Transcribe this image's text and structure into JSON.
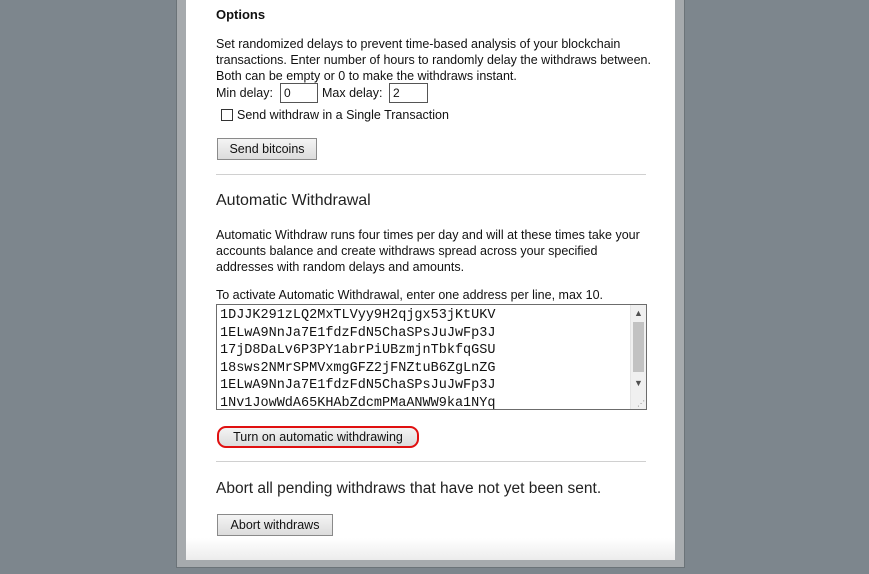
{
  "options": {
    "title": "Options",
    "description": "Set randomized delays to prevent time-based analysis of your blockchain transactions. Enter number of hours to randomly delay the withdraws between. Both can be empty or 0 to make the withdraws instant.",
    "min_delay_label": "Min delay:",
    "min_delay_value": "0",
    "max_delay_label": "Max delay:",
    "max_delay_value": "2",
    "single_tx_label": "Send withdraw in a Single Transaction",
    "single_tx_checked": false,
    "send_button": "Send bitcoins"
  },
  "automatic": {
    "title": "Automatic Withdrawal",
    "description": "Automatic Withdraw runs four times per day and will at these times take your accounts balance and create withdraws spread across your specified addresses with random delays and amounts.",
    "instruction": "To activate Automatic Withdrawal, enter one address per line, max 10.",
    "addresses": [
      "1DJJK291zLQ2MxTLVyy9H2qjgx53jKtUKV",
      "1ELwA9NnJa7E1fdzFdN5ChaSPsJuJwFp3J",
      "17jD8DaLv6P3PY1abrPiUBzmjnTbkfqGSU",
      "18sws2NMrSPMVxmgGFZ2jFNZtuB6ZgLnZG",
      "1ELwA9NnJa7E1fdzFdN5ChaSPsJuJwFp3J",
      "1Nv1JowWdA65KHAbZdcmPMaANWW9ka1NYq"
    ],
    "turn_on_button": "Turn on automatic withdrawing"
  },
  "abort": {
    "text": "Abort all pending withdraws that have not yet been sent.",
    "button": "Abort withdraws"
  },
  "colors": {
    "highlight": "#e01010",
    "page_bg": "#7d868d"
  }
}
